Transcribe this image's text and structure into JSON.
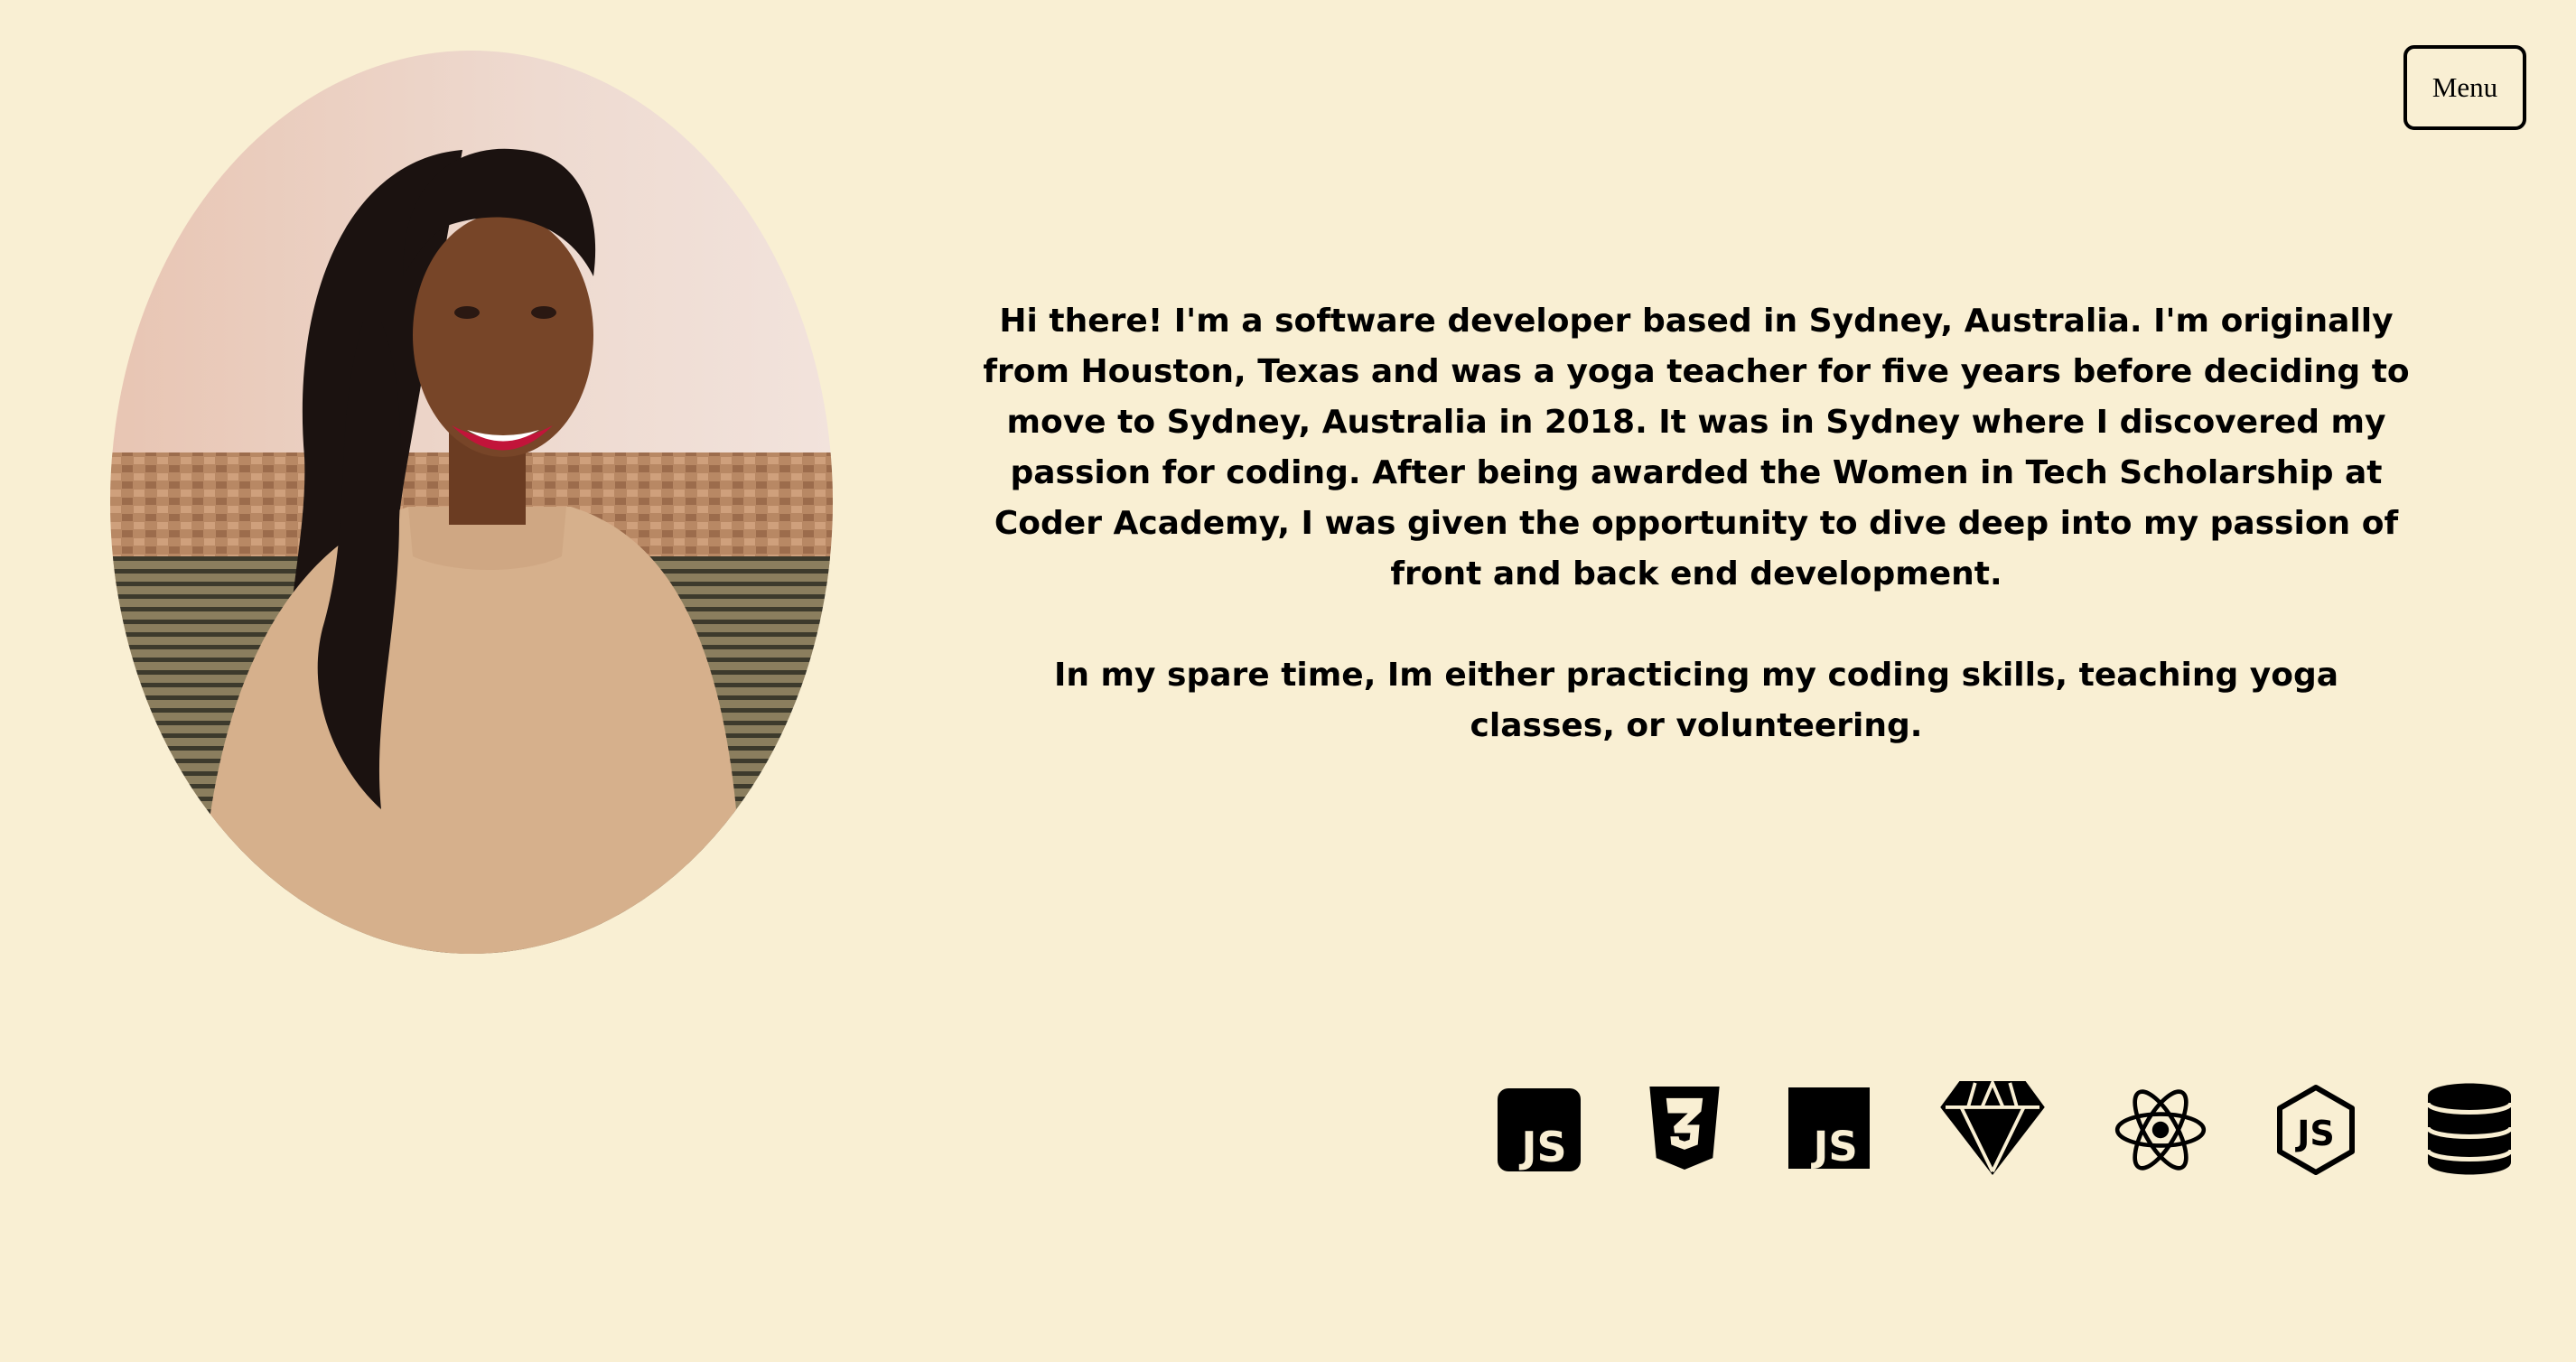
{
  "header": {
    "menu_label": "Menu"
  },
  "profile": {
    "photo_icon": "portrait-photo"
  },
  "bio": {
    "paragraphs": [
      "Hi there! I'm a software developer based in Sydney, Australia. I'm originally from Houston, Texas and was a yoga teacher for five years before deciding to move to Sydney, Australia in 2018. It was in Sydney where I discovered my passion for coding. After being awarded the Women in Tech Scholarship at Coder Academy, I was given the opportunity to dive deep into my passion of front and back end development.",
      "In my spare time, Im either practicing my coding skills, teaching yoga classes, or volunteering."
    ]
  },
  "skills": {
    "icons": [
      "javascript-rounded-icon",
      "css3-icon",
      "javascript-square-icon",
      "sass-gem-icon",
      "react-icon",
      "nodejs-icon",
      "database-icon"
    ]
  },
  "colors": {
    "background": "#f9efd3",
    "text": "#000000"
  }
}
